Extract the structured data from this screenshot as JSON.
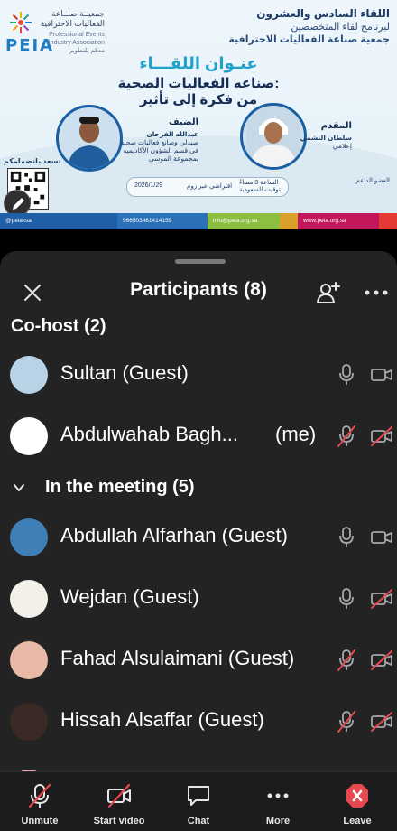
{
  "banner": {
    "logo_word": "PEIA",
    "logo_ar": "جمعيــة صنــاعة الفعاليات الاحترافية",
    "logo_en": "Professional Events Industry Association",
    "logo_en2": "معكم للتطوير",
    "line1": "اللقاء السادس والعشرون",
    "line2": "لبرنامج لقاء المتخصصين",
    "line3": "جمعية صناعة الفعاليات الاحترافية",
    "topic_title": "عنـوان اللقـــاء",
    "topic_line1": "صناعه الفعاليات الصحية:",
    "topic_line2": "من فكرة إلى تأثير",
    "guest_role": "الضيف",
    "guest_name": "عبدالله الفرحان",
    "guest_bio1": "صيدلي وصانع فعاليات صحية",
    "guest_bio2": "في قسم الشؤون الأكاديمية",
    "guest_bio3": "بمجموعة الموسى",
    "host_role": "المقدم",
    "host_name": "سلطان النشمي",
    "host_bio": "إعلامي",
    "qr_label": "تسعد بانضمامكم",
    "time_text": "الساعة 8 مساءً",
    "time_sub": "توقيت السعودية",
    "platform_text": "افتراضي عبر زوم",
    "date_text": "2026/1/29",
    "sponsor_text": "العضو الداعم",
    "footer": [
      {
        "text": "@peiaksa",
        "color": "#1e5fa5"
      },
      {
        "text": "966503461414159",
        "color": "#2a71b8"
      },
      {
        "text": "info@peia.org.sa",
        "color": "#8cbf3f"
      },
      {
        "text": "",
        "color": "#d9a12b"
      },
      {
        "text": "www.peia.org.sa",
        "color": "#c2185b"
      },
      {
        "text": "",
        "color": "#e53935"
      }
    ]
  },
  "sheet": {
    "title": "Participants (8)",
    "close_label": "close",
    "cohost_label": "Co-host (2)",
    "meeting_label": "In the meeting (5)",
    "me_label": "(me)",
    "cohosts": [
      {
        "name": "Sultan (Guest)",
        "avatar_color": "#b9d3e6",
        "mic_muted": false,
        "video_off": false
      },
      {
        "name": "Abdulwahab Bagh...",
        "avatar_color": "#ffffff",
        "mic_muted": true,
        "video_off": true
      }
    ],
    "attendees": [
      {
        "name": "Abdullah Alfarhan (Guest)",
        "avatar_color": "#3e7fb8",
        "mic_muted": false,
        "video_off": false
      },
      {
        "name": "Wejdan (Guest)",
        "avatar_color": "#f3efe9",
        "mic_muted": false,
        "video_off": true
      },
      {
        "name": "Fahad Alsulaimani (Guest)",
        "avatar_color": "#e8b9a6",
        "mic_muted": true,
        "video_off": true
      },
      {
        "name": "Hissah Alsaffar (Guest)",
        "avatar_color": "#3a2a25",
        "mic_muted": true,
        "video_off": true
      }
    ]
  },
  "toolbar": {
    "unmute": "Unmute",
    "start_video": "Start video",
    "chat": "Chat",
    "more": "More",
    "leave": "Leave"
  },
  "colors": {
    "sheet_bg": "#232324",
    "muted_red": "#e5484d",
    "icon_grey": "#a8a8ad"
  }
}
